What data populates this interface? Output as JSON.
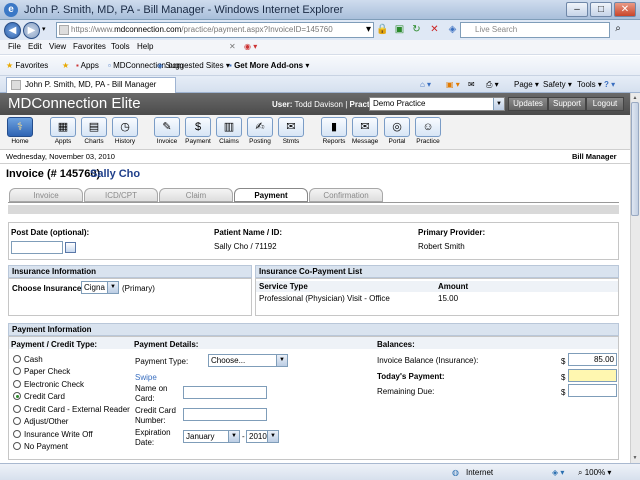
{
  "window": {
    "title": "John P. Smith, MD, PA - Bill Manager - Windows Internet Explorer",
    "ie_logo": "e",
    "min": "–",
    "max": "□",
    "close": "✕"
  },
  "address": {
    "url_prefix": "https://www.",
    "url_domain": "mdconnection.com",
    "url_path": "/practice/payment.aspx?InvoiceID=145760",
    "search_placeholder": "Live Search"
  },
  "menu": [
    "File",
    "Edit",
    "View",
    "Favorites",
    "Tools",
    "Help"
  ],
  "favorites": {
    "favorites_label": "Favorites",
    "items": [
      "Apps",
      "MDConnection.com -",
      "Suggested Sites ▾",
      "Get More Add-ons ▾"
    ]
  },
  "tab": {
    "title": "John P. Smith, MD, PA - Bill Manager",
    "commands": [
      "Page ▾",
      "Safety ▾",
      "Tools ▾"
    ]
  },
  "app": {
    "brand": "MDConnection Elite",
    "user_prefix": "User:",
    "user_name": "Todd Davison",
    "practice_label": "Practice:",
    "practice_value": "Demo Practice",
    "buttons": [
      "Updates",
      "Support",
      "Logout"
    ]
  },
  "toolbar": [
    {
      "label": "Home",
      "glyph": "⚕"
    },
    {
      "label": "Appts",
      "glyph": "▦"
    },
    {
      "label": "Charts",
      "glyph": "▤"
    },
    {
      "label": "History",
      "glyph": "◷"
    },
    {
      "label": "Invoice",
      "glyph": "✎"
    },
    {
      "label": "Payment",
      "glyph": "$"
    },
    {
      "label": "Claims",
      "glyph": "▥"
    },
    {
      "label": "Posting",
      "glyph": "✍"
    },
    {
      "label": "Stmts",
      "glyph": "✉"
    },
    {
      "label": "Reports",
      "glyph": "▮"
    },
    {
      "label": "Message",
      "glyph": "✉"
    },
    {
      "label": "Portal",
      "glyph": "◎"
    },
    {
      "label": "Practice",
      "glyph": "☺"
    }
  ],
  "datebar": {
    "date": "Wednesday, November 03, 2010",
    "module": "Bill Manager"
  },
  "invoice": {
    "heading": "Invoice (# 145760)",
    "patient": "Sally Cho"
  },
  "steps": [
    "Invoice",
    "ICD/CPT",
    "Claim",
    "Payment",
    "Confirmation"
  ],
  "info": {
    "post_date_label": "Post Date (optional):",
    "post_date_value": "",
    "patient_label": "Patient Name / ID:",
    "patient_value": "Sally Cho / 71192",
    "provider_label": "Primary Provider:",
    "provider_value": "Robert Smith"
  },
  "insurance": {
    "header": "Insurance Information",
    "choose_label": "Choose Insurance:",
    "choose_value": "Cigna",
    "primary": "(Primary)"
  },
  "copay": {
    "header": "Insurance Co-Payment List",
    "col_service": "Service Type",
    "col_amount": "Amount",
    "rows": [
      {
        "service": "Professional (Physician) Visit - Office",
        "amount": "15.00"
      }
    ]
  },
  "payment": {
    "header": "Payment Information",
    "type_label": "Payment / Credit Type:",
    "types": [
      "Cash",
      "Paper Check",
      "Electronic Check",
      "Credit Card",
      "Credit Card - External Reader",
      "Adjust/Other",
      "Insurance Write Off",
      "No Payment"
    ],
    "details_label": "Payment Details:",
    "payment_type_label": "Payment Type:",
    "payment_type_value": "Choose...",
    "swipe": "Swipe",
    "name_on_card_l1": "Name on",
    "name_on_card_l2": "Card:",
    "card_number_l1": "Credit Card",
    "card_number_l2": "Number:",
    "expiration_l1": "Expiration",
    "expiration_l2": "Date:",
    "exp_month": "January",
    "exp_sep": "-",
    "exp_year": "2010",
    "balances_label": "Balances:",
    "invoice_balance_label": "Invoice Balance (Insurance):",
    "invoice_balance_value": "85.00",
    "todays_payment_label": "Today's Payment:",
    "remaining_label": "Remaining Due:",
    "currency": "$"
  },
  "status": {
    "zone": "Internet",
    "zoom": "100%"
  },
  "colors": {
    "app_header": "#5a5a5a",
    "section_header": "#d9e3ef",
    "payment_highlight": "#fff7b0",
    "patient_name": "#1f3f8a"
  }
}
